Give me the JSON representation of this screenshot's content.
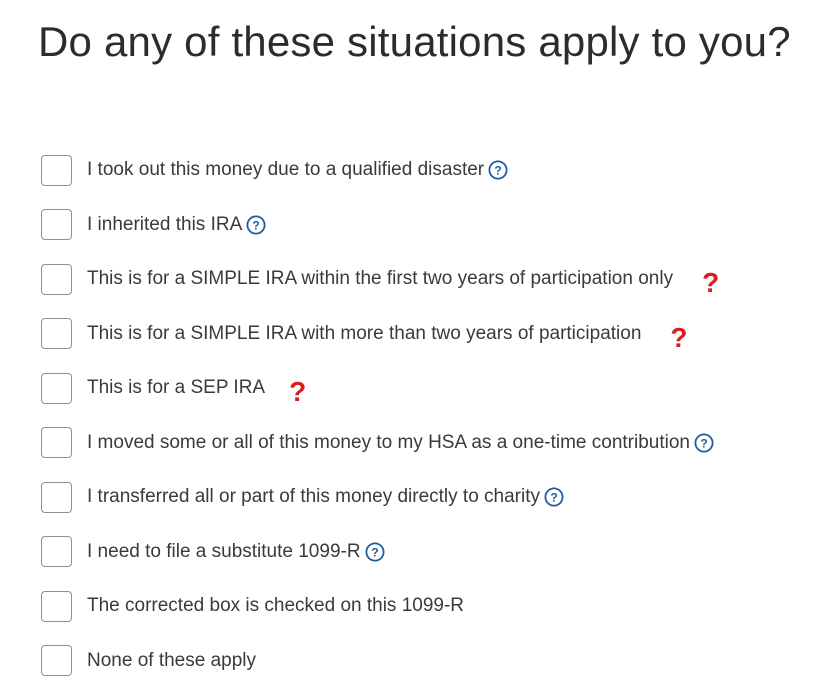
{
  "title": "Do any of these situations apply to you?",
  "options": [
    {
      "label": "I took out this money due to a qualified disaster",
      "help_icon": "help-circle-icon",
      "checked": false
    },
    {
      "label": "I inherited this IRA",
      "help_icon": "help-circle-icon",
      "checked": false
    },
    {
      "label": "This is for a SIMPLE IRA within the first two years of participation only",
      "annotation": "?",
      "checked": false
    },
    {
      "label": "This is for a SIMPLE IRA with more than two years of participation",
      "annotation": "?",
      "checked": false
    },
    {
      "label": "This is for a SEP IRA",
      "annotation": "?",
      "checked": false
    },
    {
      "label": "I moved some or all of this money to my HSA as a one-time contribution",
      "help_icon": "help-circle-icon",
      "checked": false
    },
    {
      "label": "I transferred all or part of this money directly to charity",
      "help_icon": "help-circle-icon",
      "checked": false
    },
    {
      "label": "I need to file a substitute 1099-R",
      "help_icon": "help-circle-icon",
      "checked": false
    },
    {
      "label": "The corrected box is checked on this 1099-R",
      "checked": false
    },
    {
      "label": "None of these apply",
      "checked": false
    }
  ],
  "colors": {
    "help_icon": "#1f5b9e",
    "annotation": "#d81e1e",
    "checkbox_border": "#8d9096",
    "text": "#393a3d"
  }
}
